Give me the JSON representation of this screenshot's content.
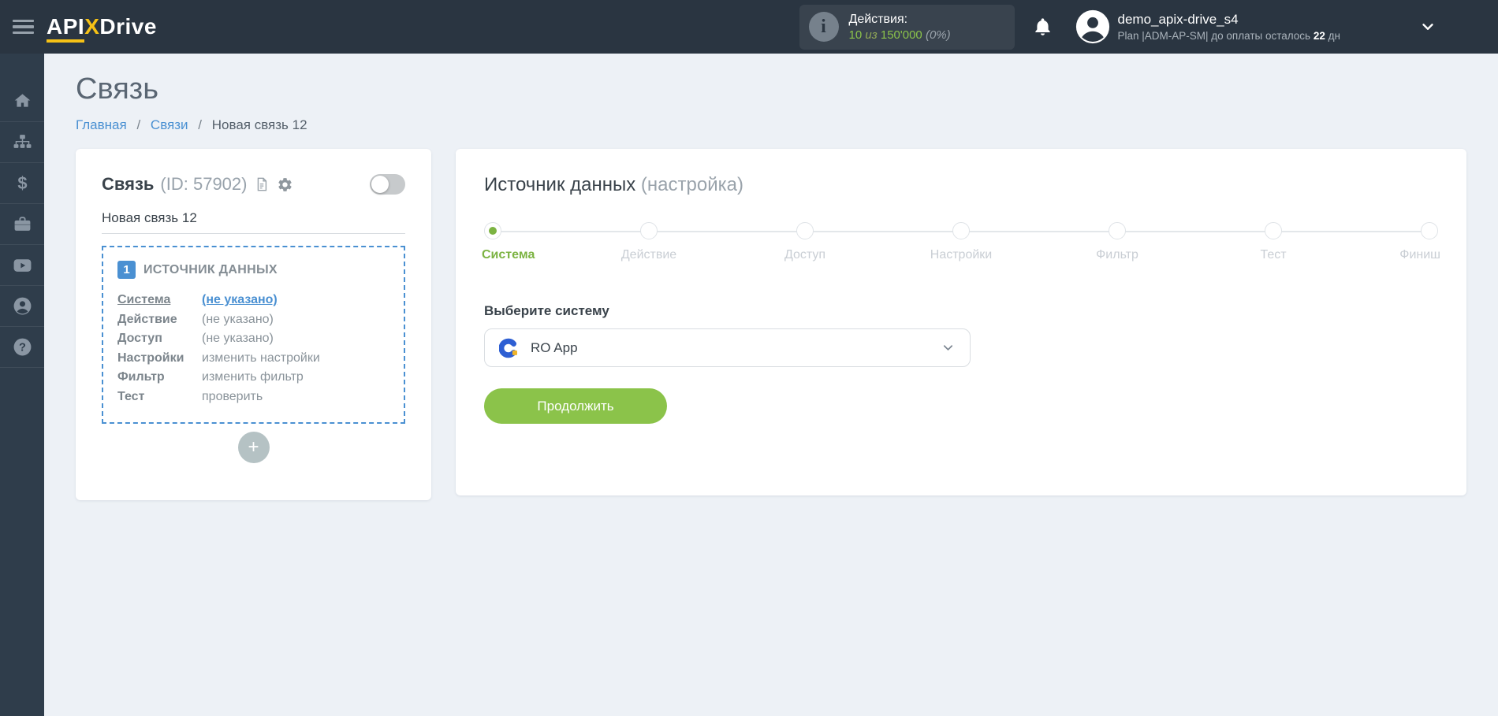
{
  "colors": {
    "accent_blue": "#4a90d2",
    "green": "#8bc34a",
    "step_green": "#7cb342",
    "navy": "#2a3541",
    "yellow": "#f6c216"
  },
  "topbar": {
    "logo": {
      "part_api": "API",
      "part_x": "X",
      "part_drive": "Drive"
    },
    "actions": {
      "label": "Действия:",
      "used": "10",
      "of_word": "из",
      "total": "150'000",
      "percent": "(0%)",
      "info_glyph": "i"
    },
    "user": {
      "name": "demo_apix-drive_s4",
      "plan_prefix": "Plan |ADM-AP-SM| до оплаты осталось",
      "days": "22",
      "days_unit": "дн"
    }
  },
  "sidebar": {
    "icons": [
      "home-icon",
      "sitemap-icon",
      "dollar-icon",
      "briefcase-icon",
      "youtube-icon",
      "person-icon",
      "help-icon"
    ],
    "dollar_glyph": "$",
    "help_glyph": "?"
  },
  "page": {
    "title": "Связь",
    "breadcrumbs": {
      "home": "Главная",
      "links": "Связи",
      "current": "Новая связь 12",
      "separator": "/"
    }
  },
  "link_card": {
    "title": "Связь",
    "id_text": "(ID: 57902)",
    "name_value": "Новая связь 12",
    "section": {
      "badge": "1",
      "title": "ИСТОЧНИК ДАННЫХ",
      "rows": [
        {
          "label": "Система",
          "value": "(не указано)"
        },
        {
          "label": "Действие",
          "value": "(не указано)"
        },
        {
          "label": "Доступ",
          "value": "(не указано)"
        },
        {
          "label": "Настройки",
          "value": "изменить настройки"
        },
        {
          "label": "Фильтр",
          "value": "изменить фильтр"
        },
        {
          "label": "Тест",
          "value": "проверить"
        }
      ]
    },
    "add_label": "+"
  },
  "source_card": {
    "title": "Источник данных",
    "subtitle": "(настройка)",
    "steps": [
      {
        "label": "Система",
        "active": true
      },
      {
        "label": "Действие",
        "active": false
      },
      {
        "label": "Доступ",
        "active": false
      },
      {
        "label": "Настройки",
        "active": false
      },
      {
        "label": "Фильтр",
        "active": false
      },
      {
        "label": "Тест",
        "active": false
      },
      {
        "label": "Финиш",
        "active": false
      }
    ],
    "select_label": "Выберите систему",
    "selected_system": "RO App",
    "continue_label": "Продолжить"
  }
}
